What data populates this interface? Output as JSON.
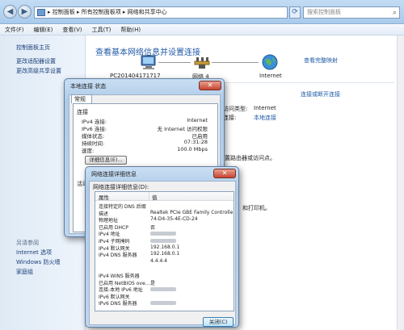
{
  "explorer": {
    "address": "▸ 控制面板 ▸ 所有控制面板项 ▸ 网络和共享中心",
    "search_placeholder": "搜索控制面板",
    "menu": [
      "文件(F)",
      "编辑(E)",
      "查看(V)",
      "工具(T)",
      "帮助(H)"
    ],
    "sidebar_links": [
      "控制面板主页",
      "更改适配器设置",
      "更改高级共享设置"
    ],
    "see_also_title": "另请参阅",
    "see_also": [
      "Internet 选项",
      "Windows 防火墙",
      "家庭组"
    ]
  },
  "network_center": {
    "title": "查看基本网络信息并设置连接",
    "full_map": "查看完整映射",
    "computer_name": "PC201404171717",
    "network_name": "网络  4",
    "internet_label": "Internet",
    "connect_link": "连接或断开连接",
    "access_type_label": "访问类型:",
    "access_type_value": "Internet",
    "connection_label": "连接:",
    "connection_value": "本地连接",
    "partial_text_1": "设置路由器或访问点。",
    "partial_text_2": "和打印机。"
  },
  "status_dialog": {
    "title": "本地连接 状态",
    "tab": "常规",
    "section_connection": "连接",
    "rows": [
      {
        "label": "IPv4 连接:",
        "value": "Internet"
      },
      {
        "label": "IPv6 连接:",
        "value": "无 Internet 访问权限"
      },
      {
        "label": "媒体状态:",
        "value": "已启用"
      },
      {
        "label": "持续时间:",
        "value": "07:31:28"
      },
      {
        "label": "速度:",
        "value": "100.0 Mbps"
      }
    ],
    "details_button": "详细信息(E)...",
    "section_activity": "活动"
  },
  "details_dialog": {
    "title": "网络连接详细信息",
    "caption": "网络连接详细信息(D):",
    "col_property": "属性",
    "col_value": "值",
    "rows": [
      {
        "p": "连接特定的 DNS 后缀",
        "v": ""
      },
      {
        "p": "描述",
        "v": "Realtek PCIe GBE Family Controlle"
      },
      {
        "p": "物理地址",
        "v": "74-D4-35-4E-CD-24"
      },
      {
        "p": "已启用 DHCP",
        "v": "否"
      },
      {
        "p": "IPv4 地址",
        "v": "",
        "blur": true
      },
      {
        "p": "IPv4 子网掩码",
        "v": "",
        "blur": true
      },
      {
        "p": "IPv4 默认网关",
        "v": "192.168.0.1"
      },
      {
        "p": "IPv4 DNS 服务器",
        "v": "192.168.0.1"
      },
      {
        "p": "",
        "v": "4.4.4.4"
      },
      {
        "p": "",
        "v": ""
      },
      {
        "p": "IPv4 WINS 服务器",
        "v": ""
      },
      {
        "p": "已启用 NetBIOS ove...",
        "v": "是"
      },
      {
        "p": "连接-本地 IPv6 地址",
        "v": "",
        "blur": true
      },
      {
        "p": "IPv6 默认网关",
        "v": ""
      },
      {
        "p": "IPv6 DNS 服务器",
        "v": "",
        "blur": true
      }
    ],
    "close_button": "关闭(C)"
  }
}
